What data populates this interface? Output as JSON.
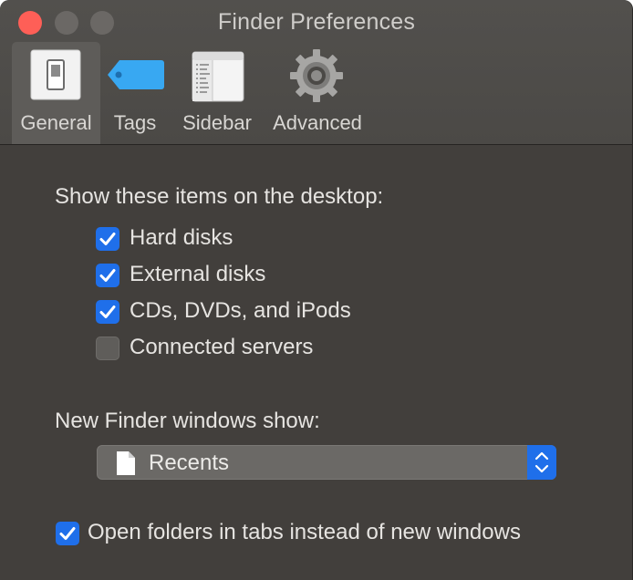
{
  "window": {
    "title": "Finder Preferences"
  },
  "toolbar": {
    "tabs": [
      {
        "label": "General",
        "icon": "general-switch-icon",
        "selected": true
      },
      {
        "label": "Tags",
        "icon": "tag-icon",
        "selected": false
      },
      {
        "label": "Sidebar",
        "icon": "sidebar-icon",
        "selected": false
      },
      {
        "label": "Advanced",
        "icon": "gear-icon",
        "selected": false
      }
    ]
  },
  "desktop_items": {
    "heading": "Show these items on the desktop:",
    "items": [
      {
        "label": "Hard disks",
        "checked": true
      },
      {
        "label": "External disks",
        "checked": true
      },
      {
        "label": "CDs, DVDs, and iPods",
        "checked": true
      },
      {
        "label": "Connected servers",
        "checked": false
      }
    ]
  },
  "new_window": {
    "heading": "New Finder windows show:",
    "selected": "Recents",
    "icon": "document-icon"
  },
  "tabs_option": {
    "label": "Open folders in tabs instead of new windows",
    "checked": true
  },
  "colors": {
    "accent": "#1f6fea",
    "close": "#fe5f57",
    "window_bg": "#423f3c",
    "toolbar_bg": "#4b4946"
  }
}
